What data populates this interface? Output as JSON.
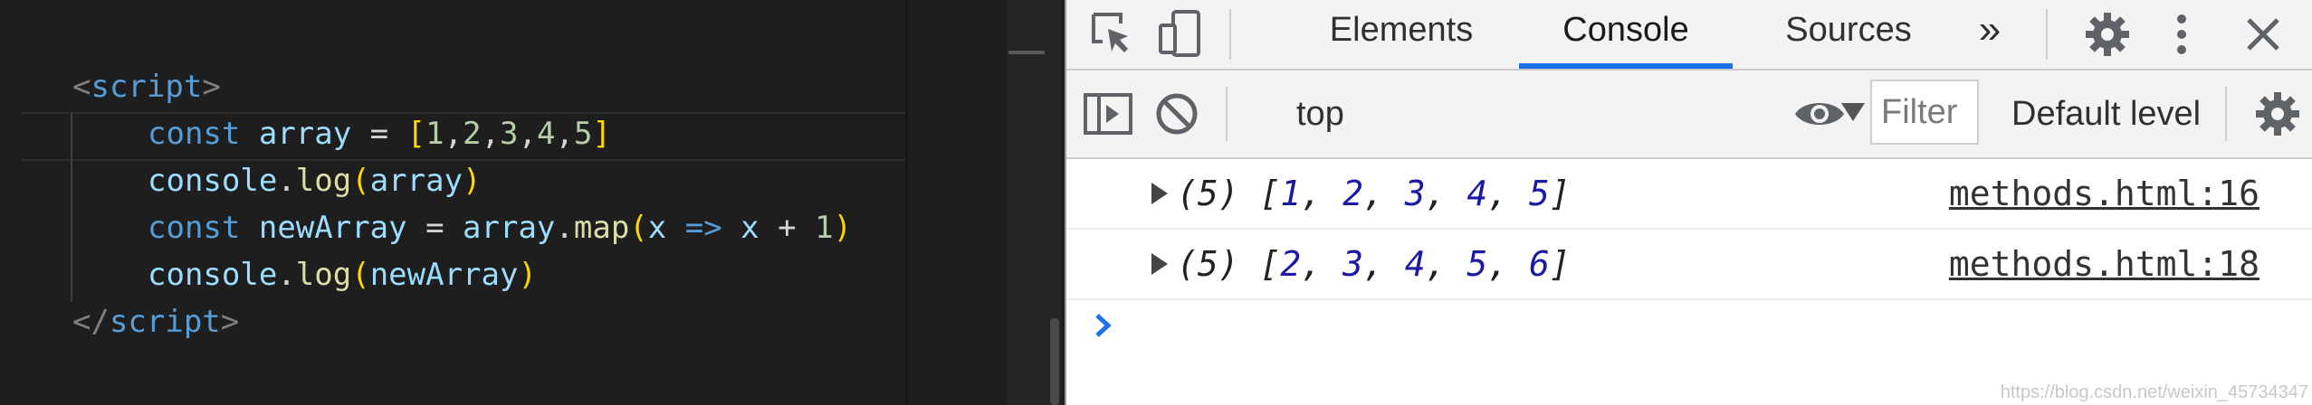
{
  "editor": {
    "lines": {
      "l1": {
        "open": "<",
        "tag": "script",
        "close": ">"
      },
      "l2": {
        "kw": "const",
        "var": "array",
        "eq": " = ",
        "lb": "[",
        "n1": "1",
        "n2": "2",
        "n3": "3",
        "n4": "4",
        "n5": "5",
        "comma": ",",
        "rb": "]"
      },
      "l3": {
        "obj": "console",
        "dot": ".",
        "fn": "log",
        "lp": "(",
        "arg": "array",
        "rp": ")"
      },
      "l4": {
        "kw": "const",
        "var": "newArray",
        "eq": " = ",
        "obj": "array",
        "dot": ".",
        "fn": "map",
        "lp": "(",
        "param": "x",
        "arrow": " => ",
        "param2": "x",
        "plus": " + ",
        "num": "1",
        "rp": ")"
      },
      "l5": {
        "obj": "console",
        "dot": ".",
        "fn": "log",
        "lp": "(",
        "arg": "newArray",
        "rp": ")"
      },
      "l6": {
        "open": "</",
        "tag": "script",
        "close": ">"
      }
    }
  },
  "devtools": {
    "tabs": [
      "Elements",
      "Console",
      "Sources"
    ],
    "active_tab": "Console",
    "more_tabs_label": "»",
    "toolbar": {
      "context": "top",
      "filter_placeholder": "Filter",
      "levels": "Default levels"
    },
    "logs": [
      {
        "count": "(5)",
        "values": [
          "1",
          "2",
          "3",
          "4",
          "5"
        ],
        "source": "methods.html:16"
      },
      {
        "count": "(5)",
        "values": [
          "2",
          "3",
          "4",
          "5",
          "6"
        ],
        "source": "methods.html:18"
      }
    ],
    "prompt_symbol": "›",
    "watermark": "https://blog.csdn.net/weixin_45734347"
  },
  "colors": {
    "accent": "#1a73e8",
    "number": "#1a1aa6",
    "editor_bg": "#1e1e1e"
  },
  "icons": {
    "tabbar": [
      "inspect-element-icon",
      "device-toolbar-icon",
      "settings-gear-icon",
      "more-vertical-icon",
      "close-icon"
    ],
    "toolbar": [
      "sidebar-toggle-icon",
      "clear-console-icon",
      "live-expression-eye-icon",
      "console-settings-gear-icon"
    ]
  }
}
